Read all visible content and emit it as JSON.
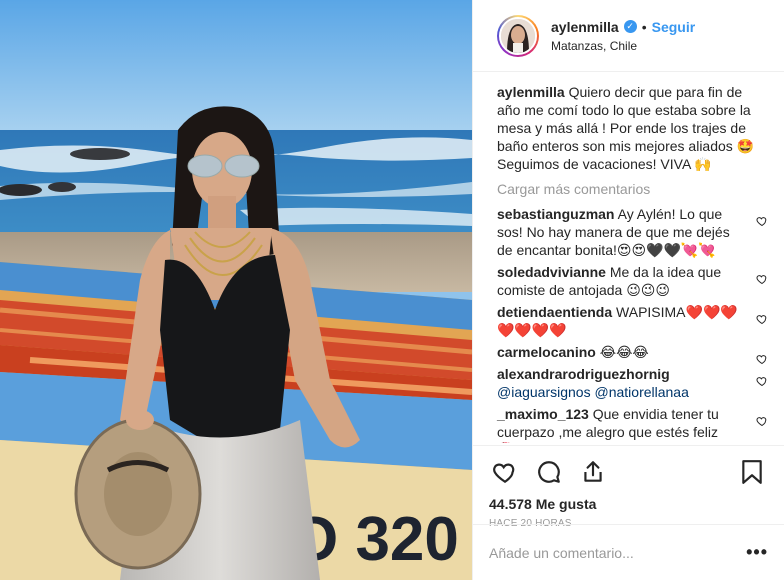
{
  "post": {
    "username": "aylenmilla",
    "verified": true,
    "separator": "•",
    "follow_label": "Seguir",
    "location": "Matanzas, Chile",
    "caption_user": "aylenmilla",
    "caption_text": "Quiero decir que para fin de año me comí todo lo que estaba sobre la mesa y más allá ! Por ende los trajes de baño enteros son mis mejores aliados 🤩 Seguimos de vacaciones! VIVA 🙌",
    "load_more": "Cargar más comentarios",
    "photo_boat_text": "O 320"
  },
  "comments": [
    {
      "user": "sebastianguzman",
      "text": "Ay Aylén! Lo que sos! No hay manera de que me dejés de encantar bonita!😍😍🖤🖤💘💘"
    },
    {
      "user": "soledadvivianne",
      "text": "Me da la idea que comiste de antojada 😉😉😉"
    },
    {
      "user": "detiendaentienda",
      "text": "WAPISIMA❤️❤️❤️ ❤️❤️❤️❤️"
    },
    {
      "user": "carmelocanino",
      "text": "😂😂😂"
    },
    {
      "user": "alexandrarodriguezhornig",
      "text": "",
      "mentions": [
        "@iaguarsignos",
        "@natiorellanaa"
      ]
    },
    {
      "user": "_maximo_123",
      "text": "Que envidia tener tu cuerpazo ,me alegro que estés feliz 🌹"
    }
  ],
  "actions": {
    "likes": "44.578 Me gusta",
    "time": "HACE 20 HORAS"
  },
  "add_comment": {
    "placeholder": "Añade un comentario...",
    "more": "•••"
  },
  "colors": {
    "link": "#3897f0",
    "muted": "#999999",
    "border": "#efefef"
  }
}
